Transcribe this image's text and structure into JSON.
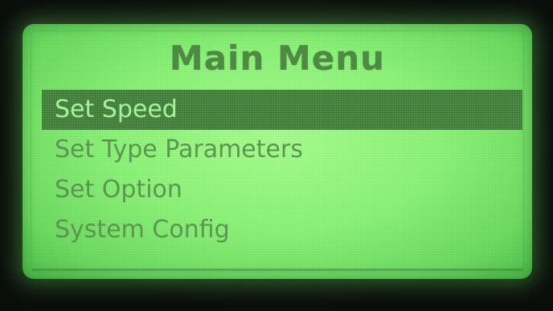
{
  "screen": {
    "title": "Main Menu",
    "menu": [
      {
        "label": "Set Speed",
        "selected": true
      },
      {
        "label": "Set Type Parameters",
        "selected": false
      },
      {
        "label": "Set Option",
        "selected": false
      },
      {
        "label": "System Config",
        "selected": false
      }
    ]
  },
  "colors": {
    "lcd_background": "#8df57a",
    "text": "#5b9651",
    "highlight_bar": "#4d8e46",
    "highlight_text": "#a6f39a"
  }
}
